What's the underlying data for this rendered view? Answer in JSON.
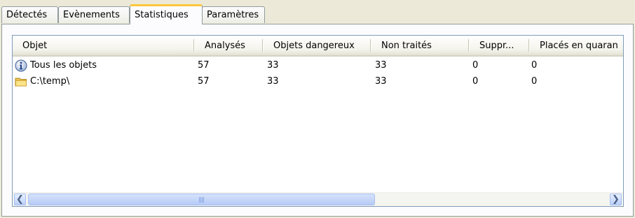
{
  "tabs": [
    {
      "label": "Détectés"
    },
    {
      "label": "Evènements"
    },
    {
      "label": "Statistiques"
    },
    {
      "label": "Paramètres"
    }
  ],
  "active_tab": "Statistiques",
  "table": {
    "columns": [
      "Objet",
      "Analysés",
      "Objets dangereux",
      "Non traités",
      "Suppr...",
      "Placés en quaran"
    ],
    "rows": [
      {
        "icon": "info-icon",
        "objet": "Tous les objets",
        "analyses": "57",
        "dangereux": "33",
        "non_traites": "33",
        "suppr": "0",
        "quarantaine": "0"
      },
      {
        "icon": "folder-icon",
        "objet": "C:\\temp\\",
        "analyses": "57",
        "dangereux": "33",
        "non_traites": "33",
        "suppr": "0",
        "quarantaine": "0"
      }
    ]
  },
  "scrollbar": {
    "grip_glyph": "III"
  }
}
